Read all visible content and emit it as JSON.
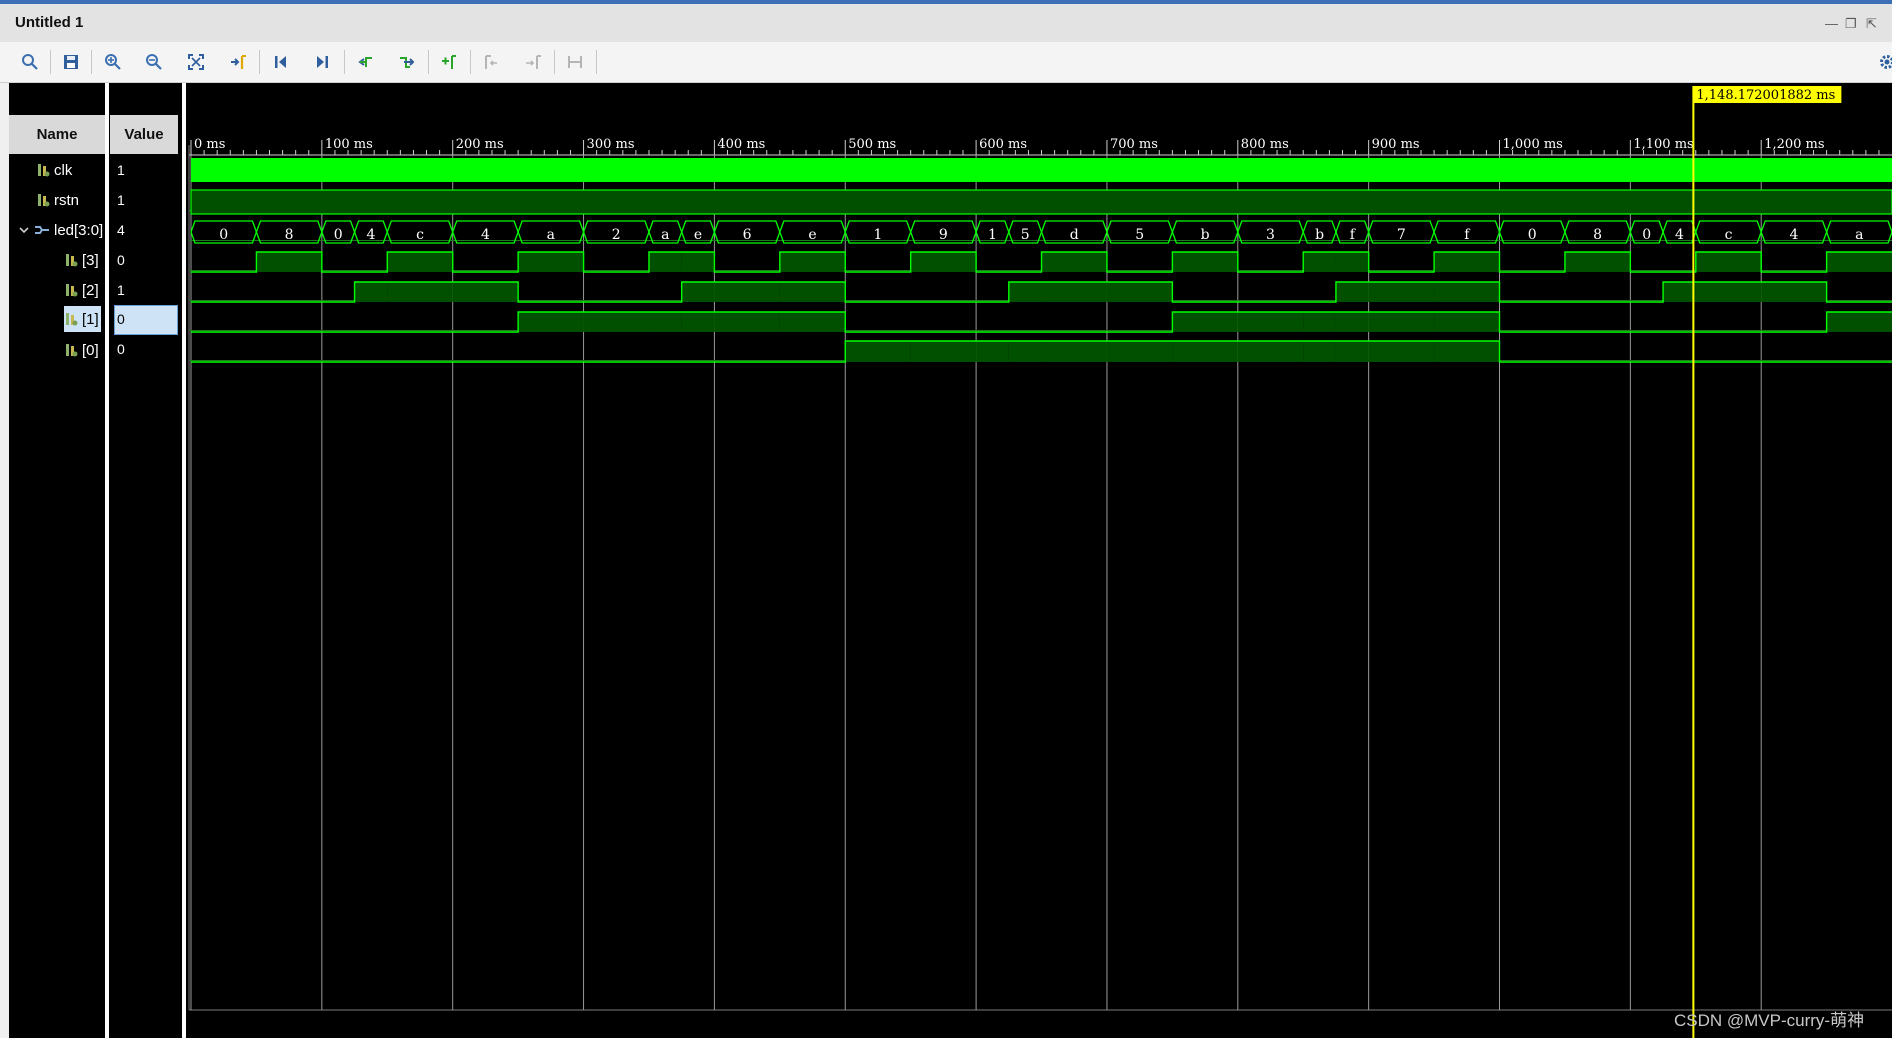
{
  "window": {
    "title": "Untitled 1"
  },
  "toolbar": {
    "items": [
      "search-icon",
      "save-icon",
      "zoom-in-icon",
      "zoom-out-icon",
      "zoom-fit-icon",
      "go-to-cursor-icon",
      "go-to-start-icon",
      "go-to-end-icon",
      "previous-transition-icon",
      "next-transition-icon",
      "add-marker-icon",
      "previous-marker-icon",
      "next-marker-icon",
      "swap-cursors-icon"
    ]
  },
  "columns": {
    "name": "Name",
    "value": "Value"
  },
  "signals": [
    {
      "name": "clk",
      "value": "1"
    },
    {
      "name": "rstn",
      "value": "1"
    },
    {
      "name": "led[3:0]",
      "value": "4"
    },
    {
      "name": "[3]",
      "value": "0"
    },
    {
      "name": "[2]",
      "value": "1"
    },
    {
      "name": "[1]",
      "value": "0"
    },
    {
      "name": "[0]",
      "value": "0"
    }
  ],
  "timeline": {
    "ticks": [
      "0 ms",
      "100 ms",
      "200 ms",
      "300 ms",
      "400 ms",
      "500 ms",
      "600 ms",
      "700 ms",
      "800 ms",
      "900 ms",
      "1,000 ms",
      "1,100 ms",
      "1,200 ms"
    ],
    "cursor_label": "1,148.172001882 ms",
    "cursor_time_ms": 1148.172
  },
  "bus_values": [
    "0",
    "8",
    "0",
    "4",
    "c",
    "4",
    "a",
    "2",
    "a",
    "e",
    "6",
    "e",
    "1",
    "9",
    "1",
    "5",
    "d",
    "5",
    "b",
    "3",
    "b",
    "f",
    "7",
    "f",
    "0",
    "8",
    "0",
    "4",
    "c",
    "4",
    "a"
  ],
  "bus_times_ms": [
    0,
    50,
    100,
    125,
    150,
    200,
    250,
    300,
    350,
    375,
    400,
    450,
    500,
    550,
    600,
    625,
    650,
    700,
    750,
    800,
    850,
    875,
    900,
    950,
    1000,
    1050,
    1100,
    1125,
    1150,
    1200,
    1250,
    1300
  ],
  "colors": {
    "wave": "#00ff00",
    "wave_fill": "#005000",
    "cursor": "#ffff00",
    "grid": "#9a9a9a"
  },
  "watermark": "CSDN @MVP-curry-萌神"
}
